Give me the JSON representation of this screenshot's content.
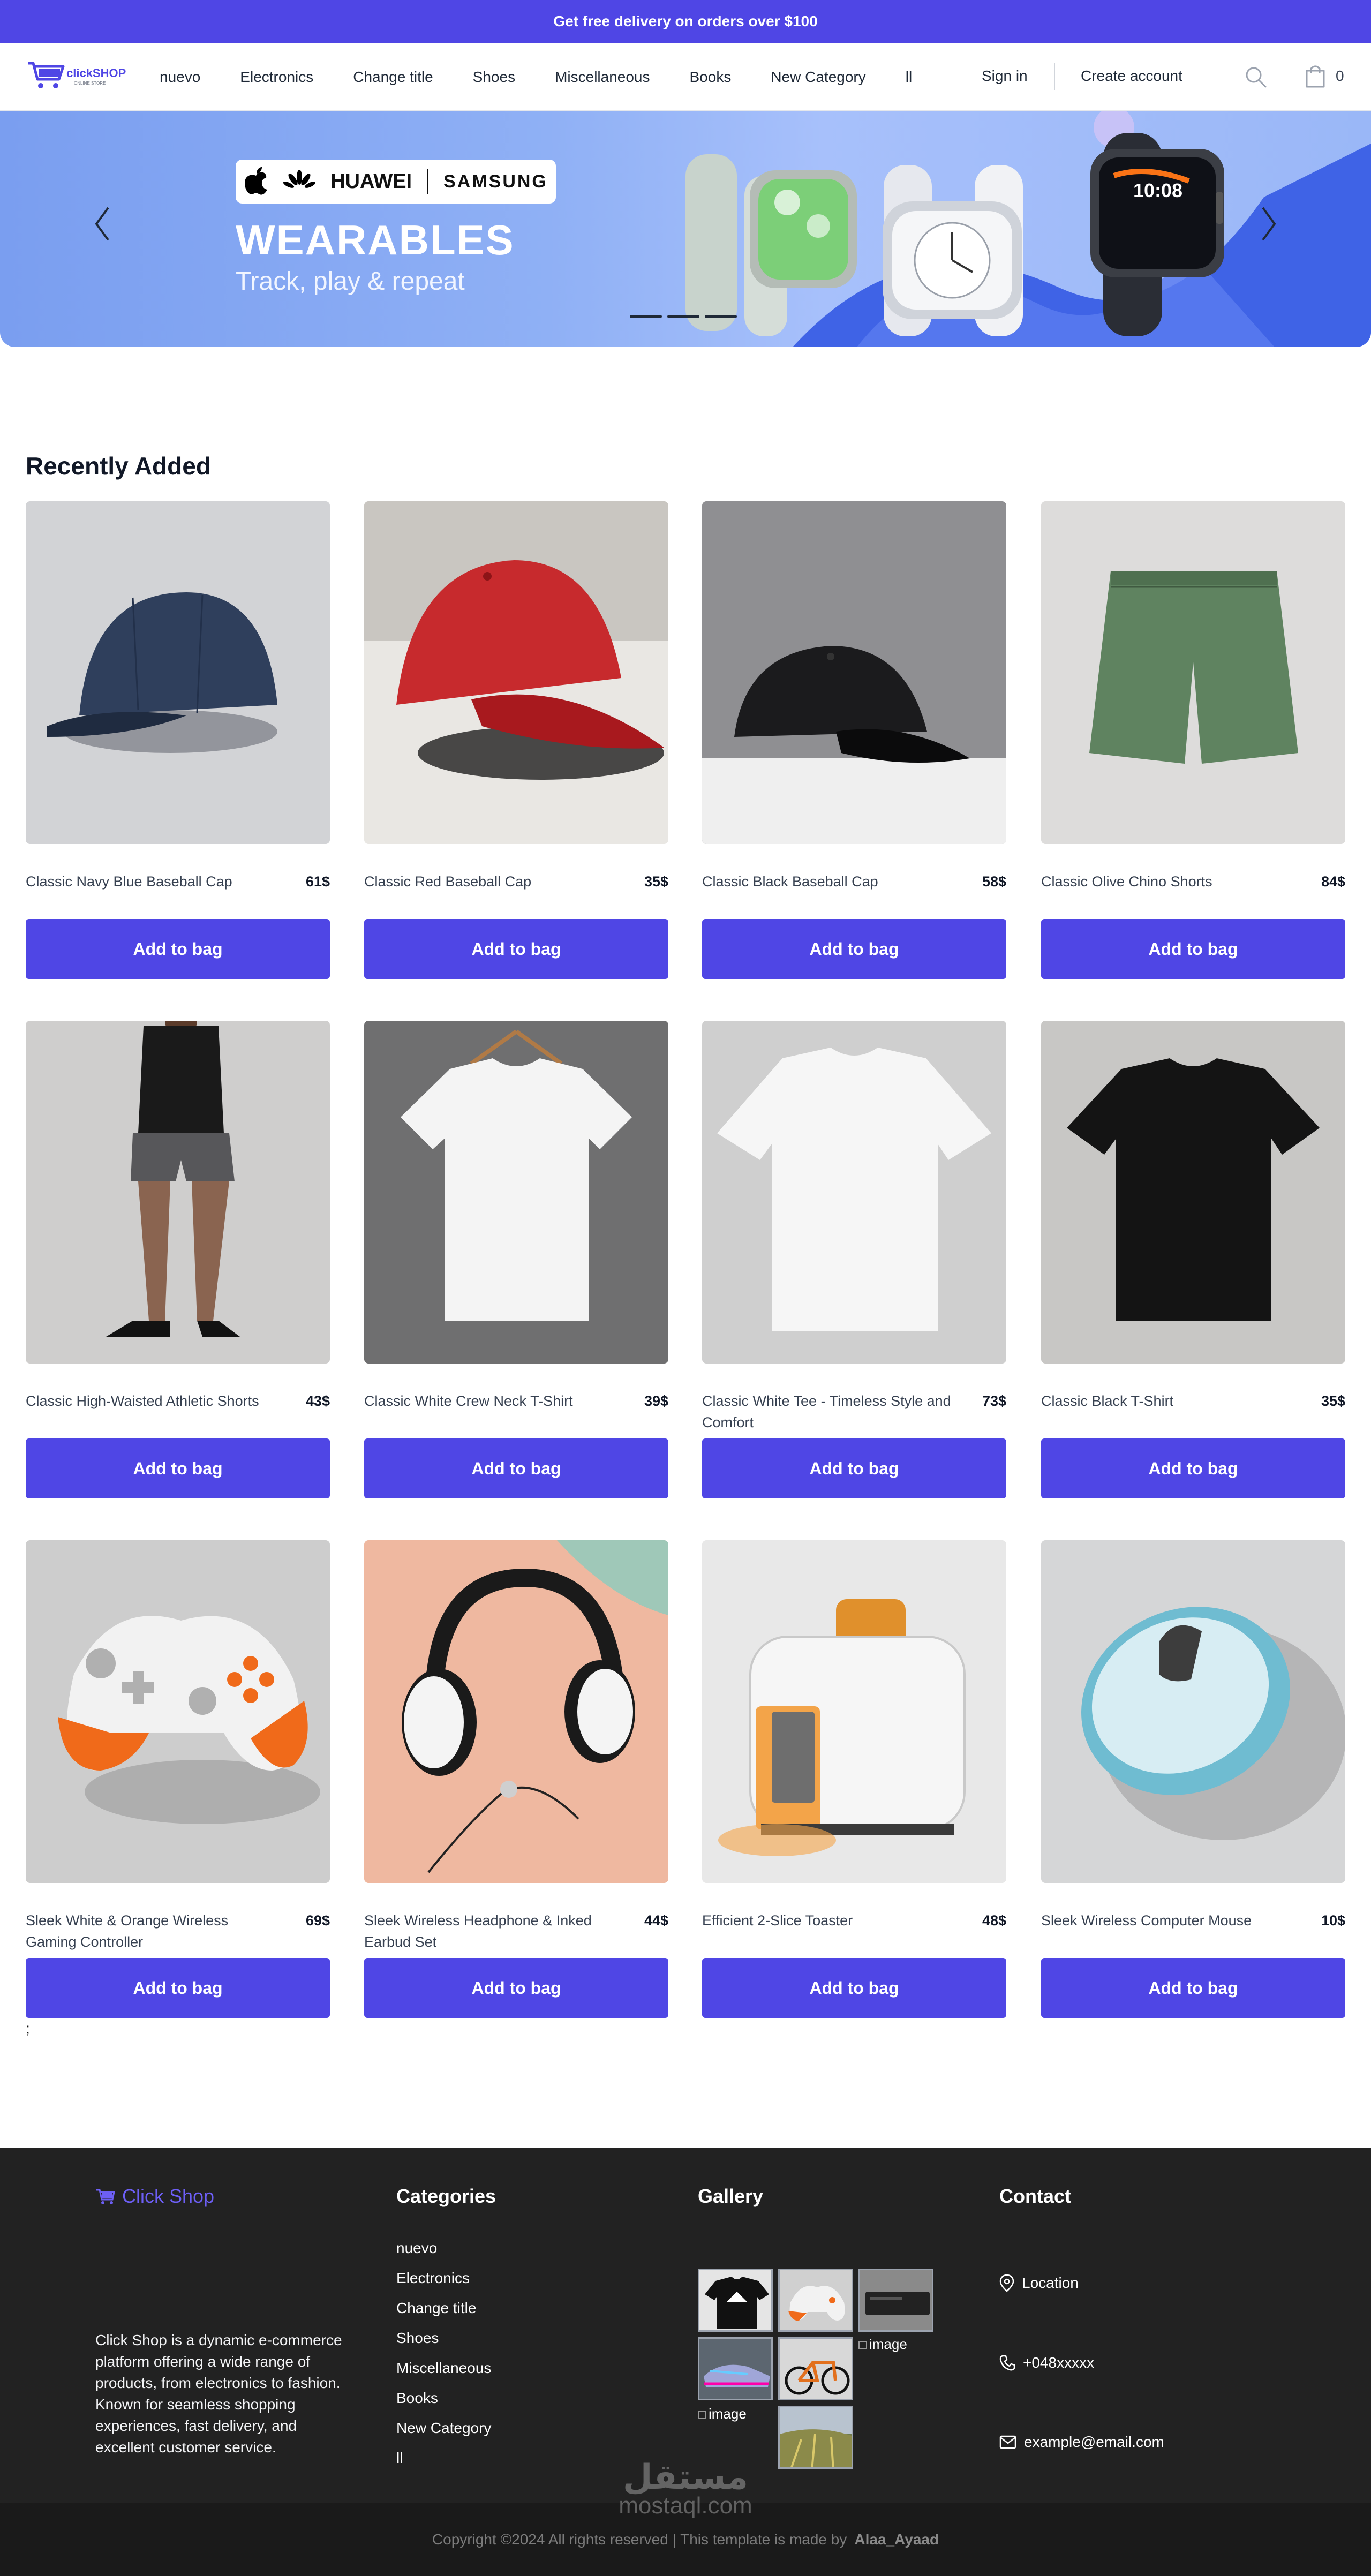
{
  "topbar": {
    "text": "Get free delivery on orders over $100"
  },
  "brand": {
    "logo_text_main": "clickSHOP",
    "logo_tagline": "ONLINE STORE"
  },
  "nav": {
    "items": [
      "nuevo",
      "Electronics",
      "Change title",
      "Shoes",
      "Miscellaneous",
      "Books",
      "New Category",
      "ll"
    ],
    "sign_in": "Sign in",
    "create_account": "Create account",
    "cart_count": "0"
  },
  "hero": {
    "brands": [
      "HUAWEI",
      "SAMSUNG"
    ],
    "title": "WEARABLES",
    "subtitle": "Track, play & repeat",
    "watch_time": "10:08",
    "slides_total": 3
  },
  "recent": {
    "title": "Recently Added",
    "button_label": "Add to bag",
    "products": [
      {
        "name": "Classic Navy Blue Baseball Cap",
        "price": "61$"
      },
      {
        "name": "Classic Red Baseball Cap",
        "price": "35$"
      },
      {
        "name": "Classic Black Baseball Cap",
        "price": "58$"
      },
      {
        "name": "Classic Olive Chino Shorts",
        "price": "84$"
      },
      {
        "name": "Classic High-Waisted Athletic Shorts",
        "price": "43$"
      },
      {
        "name": "Classic White Crew Neck T-Shirt",
        "price": "39$"
      },
      {
        "name": "Classic White Tee - Timeless Style and Comfort",
        "price": "73$"
      },
      {
        "name": "Classic Black T-Shirt",
        "price": "35$"
      },
      {
        "name": "Sleek White & Orange Wireless Gaming Controller",
        "price": "69$"
      },
      {
        "name": "Sleek Wireless Headphone & Inked Earbud Set",
        "price": "44$"
      },
      {
        "name": "Efficient 2-Slice Toaster",
        "price": "48$"
      },
      {
        "name": "Sleek Wireless Computer Mouse",
        "price": "10$"
      }
    ],
    "trailing_text": ";"
  },
  "footer": {
    "brand": "Click Shop",
    "description": "Click Shop is a dynamic e-commerce platform offering a wide range of products, from electronics to fashion. Known for seamless shopping experiences, fast delivery, and excellent customer service.",
    "categories_title": "Categories",
    "categories": [
      "nuevo",
      "Electronics",
      "Change title",
      "Shoes",
      "Miscellaneous",
      "Books",
      "New Category",
      "ll"
    ],
    "gallery_title": "Gallery",
    "gallery_broken_alt": "image",
    "contact_title": "Contact",
    "location": "Location",
    "phone": "+048xxxxx",
    "email": "example@email.com"
  },
  "copyright": {
    "text": "Copyright ©2024 All rights reserved | This template is made by",
    "author": "Alaa_Ayaad"
  },
  "watermark": {
    "arabic": "مستقل",
    "latin": "mostaql.com"
  },
  "colors": {
    "accent": "#4f46e5",
    "footer_bg": "#222222",
    "bottom_bg": "#1a1a1a"
  }
}
